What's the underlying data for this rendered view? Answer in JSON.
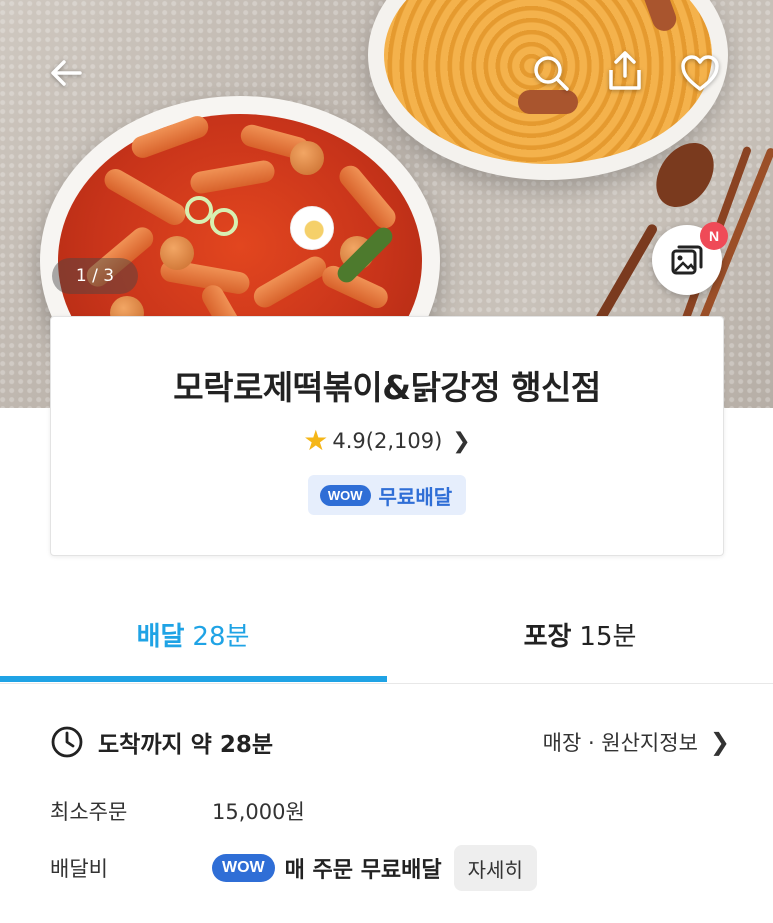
{
  "hero": {
    "photo_counter": "1 / 3",
    "new_badge": "N",
    "icons": [
      "back-arrow-icon",
      "search-icon",
      "share-icon",
      "heart-icon",
      "photo-review-icon"
    ]
  },
  "store": {
    "name": "모락로제떡볶이&닭강정 행신점",
    "rating": "4.9",
    "review_count": "(2,109)",
    "wow_label": "WOW",
    "free_delivery": "무료배달"
  },
  "tabs": [
    {
      "label": "배달",
      "time": "28분",
      "active": true
    },
    {
      "label": "포장",
      "time": "15분",
      "active": false
    }
  ],
  "info": {
    "arrival": "도착까지 약 28분",
    "store_info_link": "매장 · 원산지정보",
    "min_order_label": "최소주문",
    "min_order_value": "15,000원",
    "delivery_fee_label": "배달비",
    "wow_label": "WOW",
    "delivery_fee_value": "매 주문 무료배달",
    "detail_button": "자세히"
  },
  "colors": {
    "accent": "#1fa3e5",
    "wow_blue": "#2f6ed6",
    "star": "#f5b617",
    "badge_red": "#ef4a57"
  }
}
